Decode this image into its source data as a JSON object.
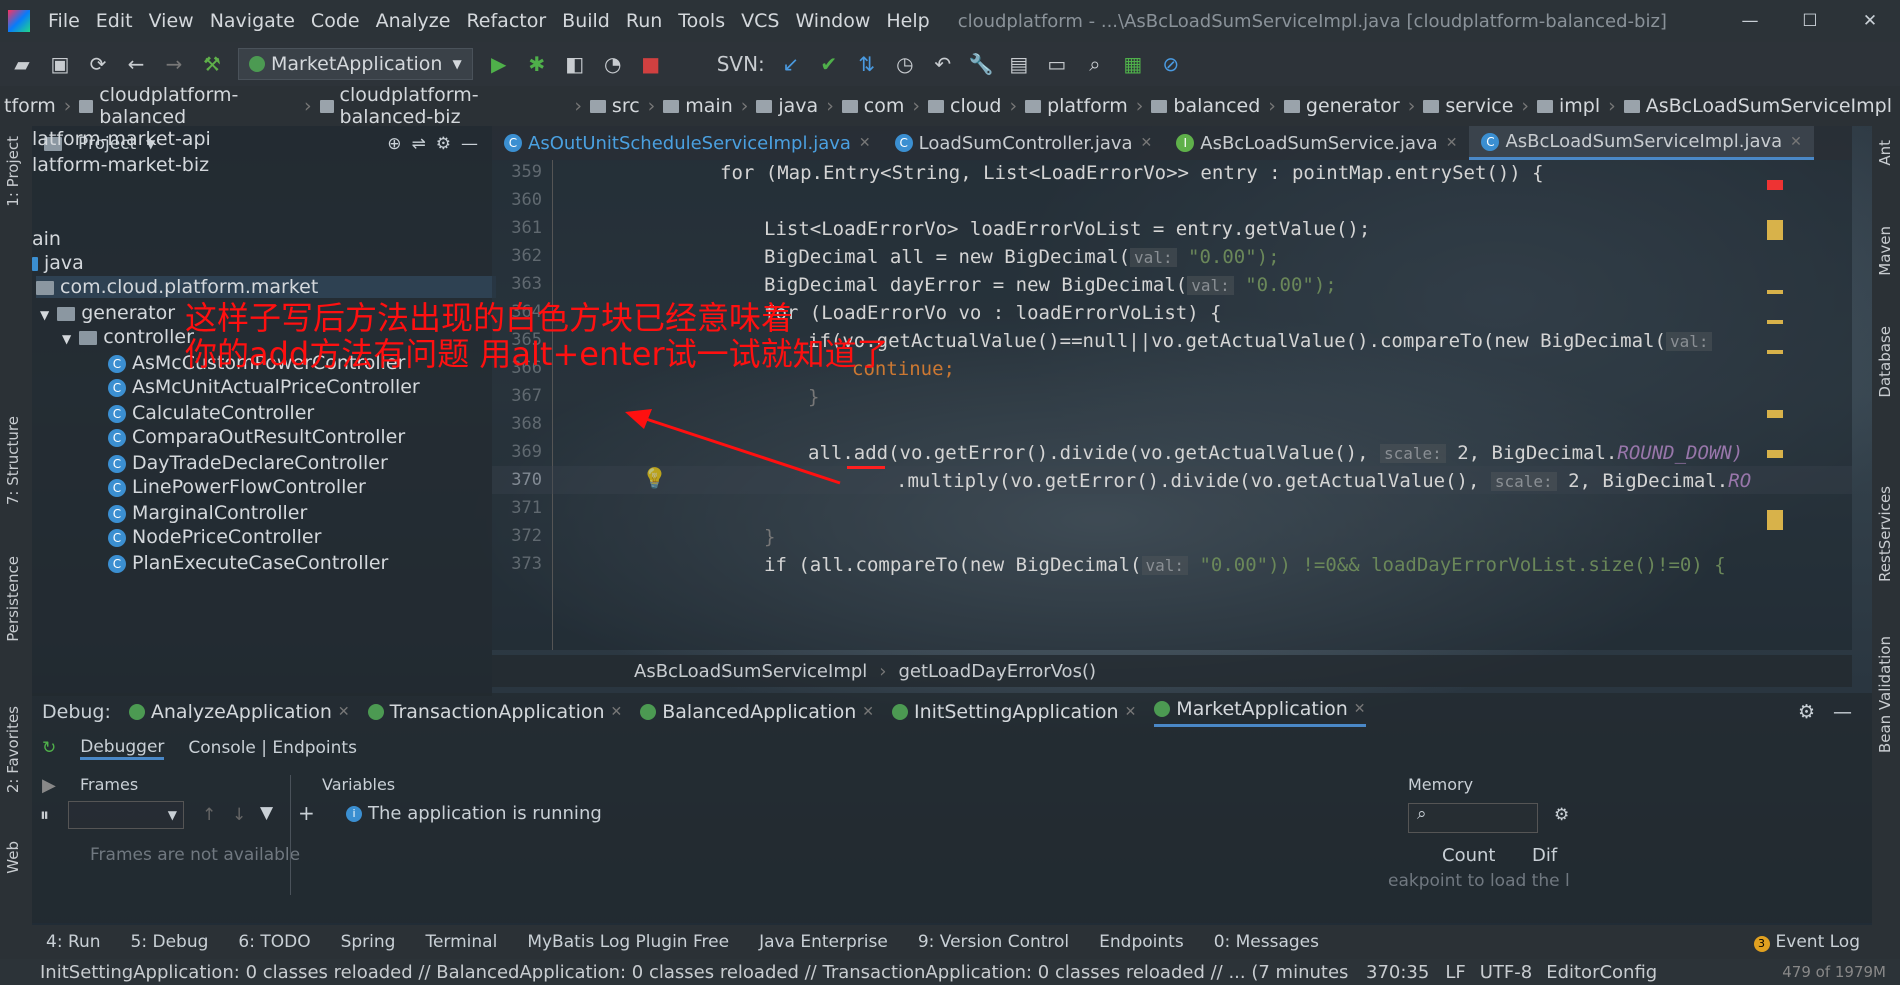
{
  "menubar": {
    "items": [
      "File",
      "Edit",
      "View",
      "Navigate",
      "Code",
      "Analyze",
      "Refactor",
      "Build",
      "Run",
      "Tools",
      "VCS",
      "Window",
      "Help"
    ],
    "window_title": "cloudplatform - ...\\AsBcLoadSumServiceImpl.java [cloudplatform-balanced-biz]"
  },
  "toolbar": {
    "run_config": "MarketApplication",
    "svn_label": "SVN:"
  },
  "navbar": {
    "crumbs": [
      "tform",
      "cloudplatform-balanced",
      "cloudplatform-balanced-biz",
      "src",
      "main",
      "java",
      "com",
      "cloud",
      "platform",
      "balanced",
      "generator",
      "service",
      "impl",
      "AsBcLoadSumServiceImpl"
    ]
  },
  "left_strip": {
    "labels": [
      "1: Project",
      "7: Structure",
      "Persistence",
      "2: Favorites",
      "Web"
    ]
  },
  "project": {
    "header": "Project",
    "tree": [
      "latform-market-api",
      "latform-market-biz",
      "ain",
      "java",
      "com.cloud.platform.market",
      "generator",
      "controller",
      "AsMcCustomPowerController",
      "AsMcUnitActualPriceController",
      "CalculateController",
      "ComparaOutResultController",
      "DayTradeDeclareController",
      "LinePowerFlowController",
      "MarginalController",
      "NodePriceController",
      "PlanExecuteCaseController"
    ]
  },
  "editor_tabs": [
    "AsOutUnitScheduleServiceImpl.java",
    "LoadSumController.java",
    "AsBcLoadSumService.java",
    "AsBcLoadSumServiceImpl.java"
  ],
  "editor": {
    "line_numbers": [
      "359",
      "360",
      "361",
      "362",
      "363",
      "364",
      "365",
      "366",
      "367",
      "368",
      "369",
      "370",
      "371",
      "372",
      "373"
    ],
    "lines": {
      "l359": "for (Map.Entry<String, List<LoadErrorVo>> entry : pointMap.entrySet()) {",
      "l361": "List<LoadErrorVo> loadErrorVoList = entry.getValue();",
      "l362a": "BigDecimal all = new BigDecimal(",
      "l362h": "val:",
      "l362b": "\"0.00\");",
      "l363a": "BigDecimal dayError = new BigDecimal(",
      "l363h": "val:",
      "l363b": "\"0.00\");",
      "l364": "for (LoadErrorVo vo : loadErrorVoList) {",
      "l365a": "if(vo.getActualValue()==null||vo.getActualValue().compareTo(new BigDecimal(",
      "l365h": "val:",
      "l366": "continue;",
      "l367": "}",
      "l369a": "all.add(vo.getError().divide(vo.getActualValue(),",
      "l369h": "scale:",
      "l369b": "2, BigDecimal.",
      "l369c": "ROUND_DOWN)",
      "l370a": ".multiply(vo.getError().divide(vo.getActualValue(),",
      "l370h": "scale:",
      "l370b": "2, BigDecimal.",
      "l370c": "RO",
      "l372": "}",
      "l373a": "if (all.compareTo(new BigDecimal(",
      "l373h": "val:",
      "l373b": "\"0.00\")) !=0&& loadDayErrorVoList.size()!=0) {"
    }
  },
  "editor_breadcrumb": [
    "AsBcLoadSumServiceImpl",
    "getLoadDayErrorVos()"
  ],
  "annotation": {
    "line1": "这样子写后方法出现的白色方块已经意味着",
    "line2": "你的add方法有问题   用alt+enter试一试就知道了"
  },
  "right_strip": {
    "labels": [
      "Ant",
      "Maven",
      "Database",
      "RestServices",
      "Bean Validation"
    ]
  },
  "debug": {
    "label": "Debug:",
    "tabs": [
      "AnalyzeApplication",
      "TransactionApplication",
      "BalancedApplication",
      "InitSettingApplication",
      "MarketApplication"
    ],
    "subtabs": [
      "Debugger",
      "Console | Endpoints"
    ],
    "frames_header": "Frames",
    "frames_empty": "Frames are not available",
    "variables_header": "Variables",
    "variables_msg": "The application is running",
    "memory_header": "Memory",
    "count_header": "Count",
    "dif_header": "Dif",
    "memory_msg": "eakpoint to load the l"
  },
  "bottom_tools": [
    "4: Run",
    "5: Debug",
    "6: TODO",
    "Spring",
    "Terminal",
    "MyBatis Log Plugin Free",
    "Java Enterprise",
    "9: Version Control",
    "Endpoints",
    "0: Messages",
    "Event Log"
  ],
  "event_log_count": "3",
  "status": {
    "message": "InitSettingApplication: 0 classes reloaded // BalancedApplication: 0 classes reloaded // TransactionApplication: 0 classes reloaded // ... (7 minutes ago)",
    "position": "370:35",
    "line_sep": "LF",
    "encoding": "UTF-8",
    "editorconfig": "EditorConfig",
    "memory": "479 of 1979M"
  }
}
